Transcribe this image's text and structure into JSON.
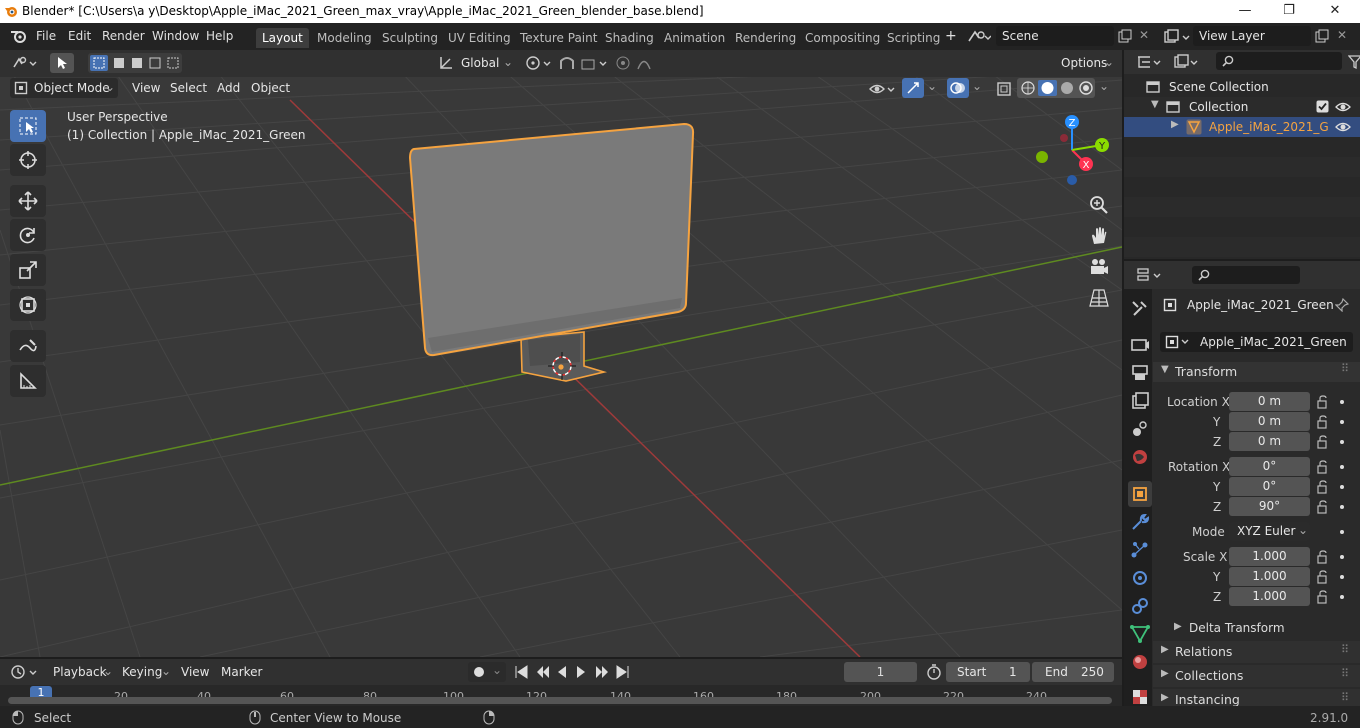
{
  "window": {
    "title": "Blender* [C:\\Users\\a y\\Desktop\\Apple_iMac_2021_Green_max_vray\\Apple_iMac_2021_Green_blender_base.blend]",
    "minimize": "—",
    "maximize": "❐",
    "close": "✕"
  },
  "menu": {
    "items": [
      "File",
      "Edit",
      "Render",
      "Window",
      "Help"
    ],
    "workspaces": [
      "Layout",
      "Modeling",
      "Sculpting",
      "UV Editing",
      "Texture Paint",
      "Shading",
      "Animation",
      "Rendering",
      "Compositing",
      "Scripting"
    ],
    "add_workspace": "+",
    "scene": "Scene",
    "view_layer": "View Layer"
  },
  "viewport_header": {
    "transform_orientation": "Global",
    "options": "Options",
    "mode": "Object Mode",
    "menus": [
      "View",
      "Select",
      "Add",
      "Object"
    ]
  },
  "viewport": {
    "perspective_label": "User Perspective",
    "collection_label": "(1) Collection | Apple_iMac_2021_Green",
    "gizmo": {
      "x": "X",
      "y": "Y",
      "z": "Z"
    }
  },
  "outliner": {
    "items": [
      {
        "label": "Scene Collection"
      },
      {
        "label": "Collection"
      },
      {
        "label": "Apple_iMac_2021_G"
      }
    ]
  },
  "properties": {
    "object_name": "Apple_iMac_2021_Green",
    "data_name": "Apple_iMac_2021_Green",
    "transform_label": "Transform",
    "location_label": "Location X",
    "rotation_label": "Rotation X",
    "scale_label": "Scale X",
    "axis_y": "Y",
    "axis_z": "Z",
    "location": [
      "0 m",
      "0 m",
      "0 m"
    ],
    "rotation": [
      "0°",
      "0°",
      "90°"
    ],
    "mode_label": "Mode",
    "mode_value": "XYZ Euler",
    "scale": [
      "1.000",
      "1.000",
      "1.000"
    ],
    "delta_transform": "Delta Transform",
    "sections": [
      "Relations",
      "Collections",
      "Instancing"
    ]
  },
  "timeline": {
    "menus": [
      "Playback",
      "Keying",
      "View",
      "Marker"
    ],
    "current_frame": "1",
    "start_label": "Start",
    "start_value": "1",
    "end_label": "End",
    "end_value": "250",
    "ticks": [
      "1",
      "20",
      "40",
      "60",
      "80",
      "100",
      "120",
      "140",
      "160",
      "180",
      "200",
      "220",
      "240"
    ]
  },
  "statusbar": {
    "select": "Select",
    "center_view": "Center View to Mouse",
    "version": "2.91.0"
  },
  "colors": {
    "selection_outline": "#f5a340",
    "active_blue": "#4772b3",
    "x_axis": "#ff3352",
    "y_axis": "#8bdc00",
    "z_axis": "#2890ff",
    "grid_red": "#9e3a3a",
    "grid_green": "#5e8a20"
  }
}
